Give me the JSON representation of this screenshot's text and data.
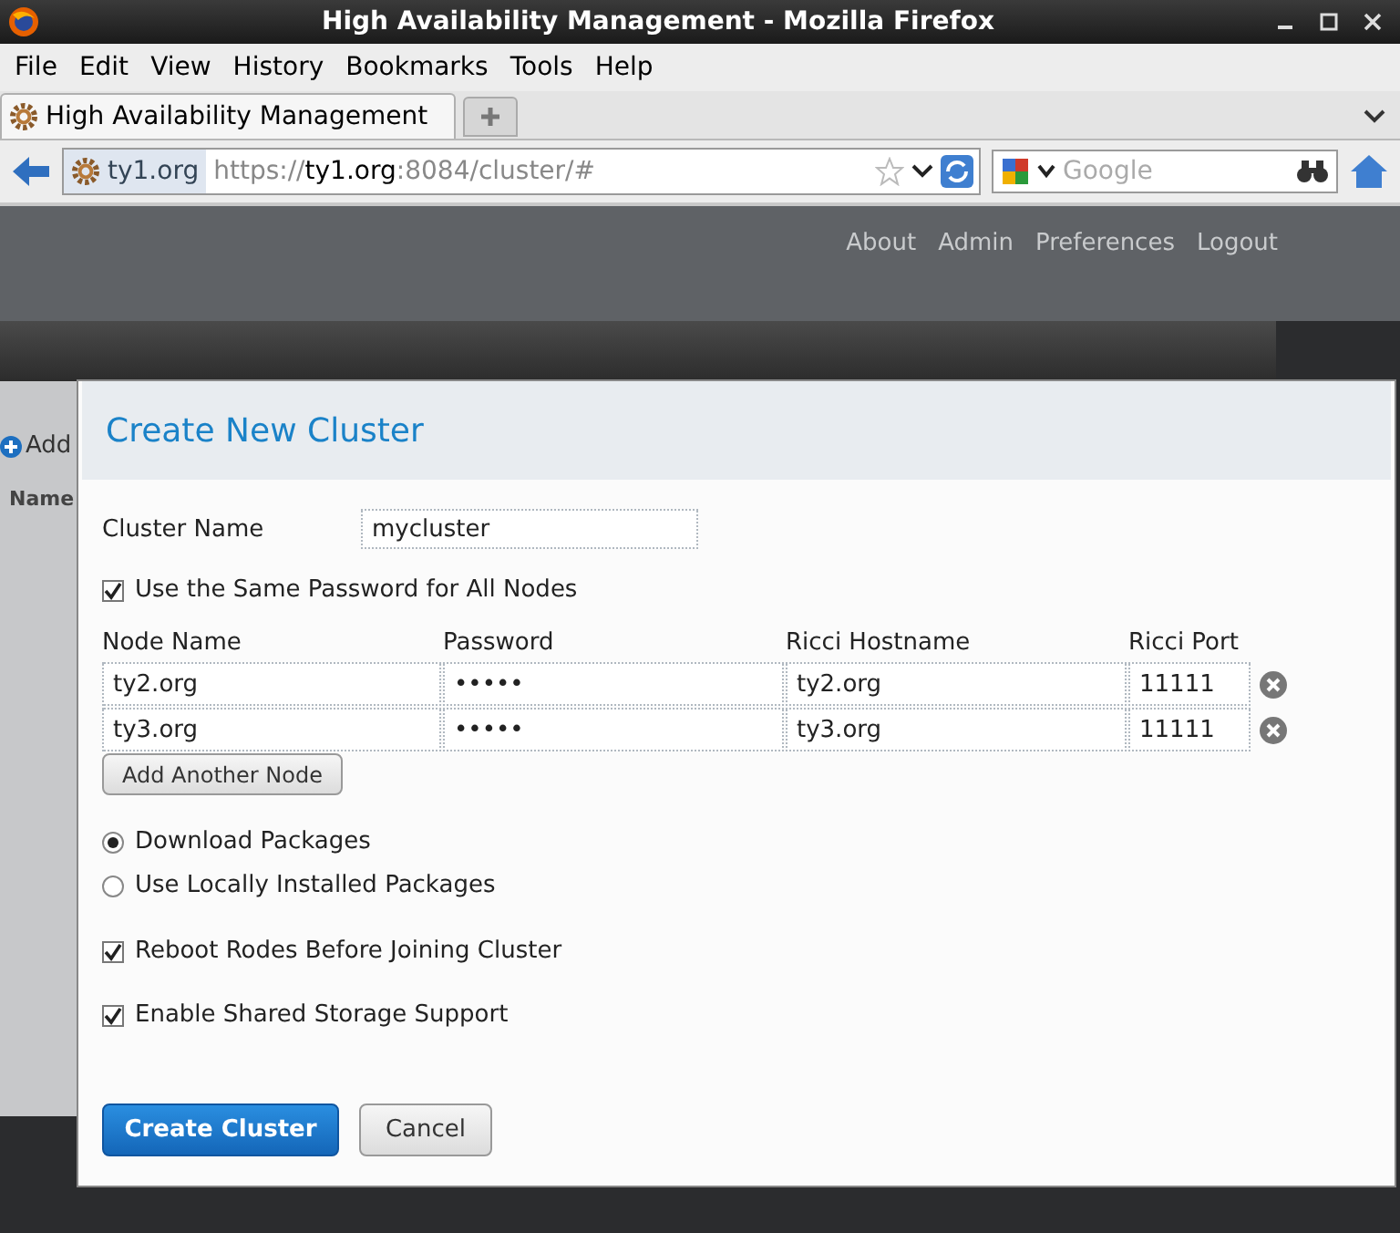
{
  "window": {
    "title": "High Availability Management - Mozilla Firefox"
  },
  "menu": [
    "File",
    "Edit",
    "View",
    "History",
    "Bookmarks",
    "Tools",
    "Help"
  ],
  "tabs": [
    {
      "label": "High Availability Management",
      "selected": true
    }
  ],
  "address_bar": {
    "site": "ty1.org",
    "scheme": "https://",
    "host": "ty1.org",
    "rest": ":8084/cluster/#"
  },
  "search": {
    "placeholder": "Google"
  },
  "top_links": [
    "About",
    "Admin",
    "Preferences",
    "Logout"
  ],
  "background": {
    "button": "Add",
    "column": "Name"
  },
  "dialog": {
    "title": "Create New Cluster",
    "cluster_name": {
      "label": "Cluster Name",
      "value": "mycluster"
    },
    "same_password": {
      "label": "Use the Same Password for All Nodes",
      "checked": true
    },
    "columns": [
      "Node Name",
      "Password",
      "Ricci Hostname",
      "Ricci Port"
    ],
    "nodes": [
      {
        "node_name": "ty2.org",
        "password": "•••••",
        "ricci_hostname": "ty2.org",
        "ricci_port": "11111"
      },
      {
        "node_name": "ty3.org",
        "password": "•••••",
        "ricci_hostname": "ty3.org",
        "ricci_port": "11111"
      }
    ],
    "add_node_button": "Add Another Node",
    "packages": [
      {
        "label": "Download Packages",
        "selected": true
      },
      {
        "label": "Use Locally Installed Packages",
        "selected": false
      }
    ],
    "options": [
      {
        "label": "Reboot Rodes Before Joining Cluster",
        "checked": true
      },
      {
        "label": "Enable Shared Storage Support",
        "checked": true
      }
    ],
    "buttons": [
      {
        "label": "Create Cluster",
        "kind": "primary"
      },
      {
        "label": "Cancel",
        "kind": "secondary"
      }
    ]
  }
}
